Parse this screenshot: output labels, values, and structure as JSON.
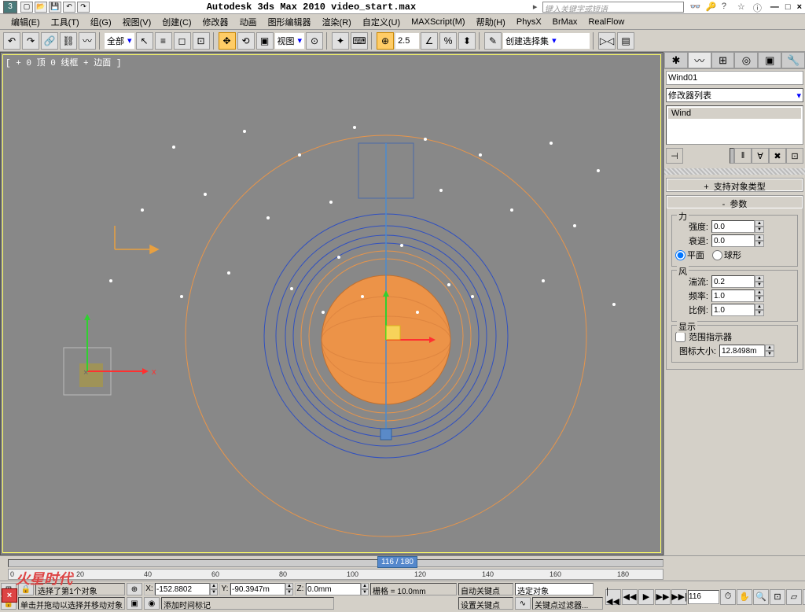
{
  "title": "Autodesk 3ds Max  2010    video_start.max",
  "search_placeholder": "键入关键字或短语",
  "menu": [
    "编辑(E)",
    "工具(T)",
    "组(G)",
    "视图(V)",
    "创建(C)",
    "修改器",
    "动画",
    "图形编辑器",
    "渲染(R)",
    "自定义(U)",
    "MAXScript(M)",
    "帮助(H)",
    "PhysX",
    "BrMax",
    "RealFlow"
  ],
  "toolbar": {
    "ref_combo": "全部",
    "view_combo": "视图",
    "spinner_val": "2.5",
    "named_set": "创建选择集"
  },
  "viewport": {
    "label": "[ + 0 顶 0 线框 + 边面 ]",
    "frame_indicator": "116 / 180"
  },
  "cmdpanel": {
    "obj_name": "Wind01",
    "modlist_label": "修改器列表",
    "stack_item": "Wind",
    "rollout_support": "支持对象类型",
    "rollout_params": "参数",
    "group_force": "力",
    "strength_label": "强度:",
    "strength_val": "0.0",
    "decay_label": "衰退:",
    "decay_val": "0.0",
    "radio_planar": "平面",
    "radio_spherical": "球形",
    "group_wind": "风",
    "turb_label": "湍流:",
    "turb_val": "0.2",
    "freq_label": "频率:",
    "freq_val": "1.0",
    "scale_label": "比例:",
    "scale_val": "1.0",
    "group_display": "显示",
    "range_check": "范围指示器",
    "icon_label": "图标大小:",
    "icon_val": "12.8498m"
  },
  "status": {
    "sel_text": "选择了第1个对象",
    "prompt": "单击并拖动以选择并移动对象",
    "x": "-152.8802",
    "y": "-90.3947m",
    "z": "0.0mm",
    "grid": "栅格 = 10.0mm",
    "autokey": "自动关键点",
    "setkey": "设置关键点",
    "sel_filter": "选定对象",
    "key_filter": "关键点过滤器...",
    "addtime": "添加时间标记",
    "frame": "116"
  }
}
